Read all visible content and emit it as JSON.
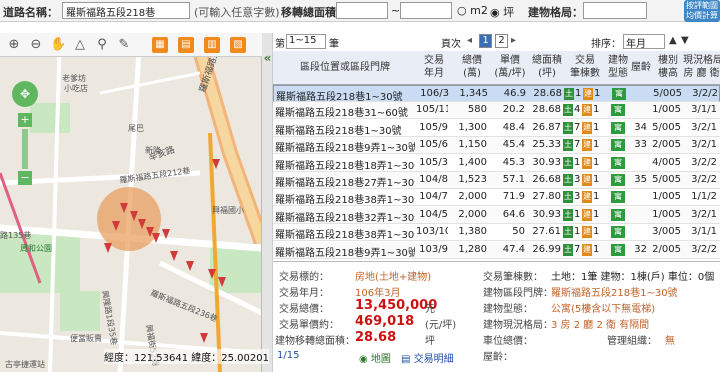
{
  "topbar": {
    "road_label": "道路名稱：",
    "road_value": "羅斯福路五段218巷",
    "road_hint": "(可輸入任意字數)",
    "area_label": "移轉總面積：",
    "area_sep": "~",
    "unit_m2": "m2",
    "unit_ping": "坪",
    "layout_label": "建物格局：",
    "calc_btn": "按評範圍均價計算"
  },
  "pager": {
    "prefix": "第",
    "range": "1~15",
    "suffix": "筆",
    "page_label": "頁次",
    "pages": [
      "1",
      "2"
    ],
    "sort_label": "排序：",
    "sort_value": "年月",
    "asc": "▲",
    "desc": "▼"
  },
  "columns": {
    "addr": "區段位置或區段門牌",
    "ym": [
      "交易",
      "年月"
    ],
    "total": [
      "總價",
      "(萬)"
    ],
    "unit": [
      "單價",
      "(萬/坪)"
    ],
    "area": [
      "總面積",
      "(坪)"
    ],
    "trans": [
      "交易",
      "筆棟數"
    ],
    "type": [
      "建物",
      "型態"
    ],
    "floor": "屋齡",
    "flr": [
      "樓別",
      "樓高"
    ],
    "layout": [
      "現況格局",
      "房 廳 衛"
    ]
  },
  "rows": [
    {
      "addr": "羅斯福路五段218巷1~30號",
      "ym": "106/3",
      "total": "1,345",
      "unit": "46.9",
      "area": "28.68",
      "land": "1",
      "bld": "1",
      "age": "",
      "flr": "5/005",
      "lay": "3/2/2"
    },
    {
      "addr": "羅斯福路五段218巷31~60號",
      "ym": "105/11",
      "total": "580",
      "unit": "20.2",
      "area": "28.68",
      "land": "4",
      "bld": "1",
      "age": "",
      "flr": "1/005",
      "lay": "3/1/1"
    },
    {
      "addr": "羅斯福路五段218巷1~30號",
      "ym": "105/9",
      "total": "1,300",
      "unit": "48.4",
      "area": "26.87",
      "land": "7",
      "bld": "1",
      "age": "34",
      "flr": "5/005",
      "lay": "3/2/1"
    },
    {
      "addr": "羅斯福路五段218巷9弄1~30號",
      "ym": "105/6",
      "total": "1,150",
      "unit": "45.4",
      "area": "25.33",
      "land": "7",
      "bld": "1",
      "age": "33",
      "flr": "2/005",
      "lay": "3/2/1"
    },
    {
      "addr": "羅斯福路五段218巷18弄1~30號",
      "ym": "105/3",
      "total": "1,400",
      "unit": "45.3",
      "area": "30.93",
      "land": "1",
      "bld": "1",
      "age": "",
      "flr": "4/005",
      "lay": "3/2/2"
    },
    {
      "addr": "羅斯福路五段218巷27弄1~30號",
      "ym": "104/8",
      "total": "1,523",
      "unit": "57.1",
      "area": "26.68",
      "land": "3",
      "bld": "1",
      "age": "35",
      "flr": "5/005",
      "lay": "3/2/2"
    },
    {
      "addr": "羅斯福路五段218巷38弄1~30號",
      "ym": "104/7",
      "total": "2,000",
      "unit": "71.9",
      "area": "27.80",
      "land": "3",
      "bld": "1",
      "age": "",
      "flr": "1/005",
      "lay": "1/1/2"
    },
    {
      "addr": "羅斯福路五段218巷32弄1~30號",
      "ym": "104/5",
      "total": "2,000",
      "unit": "64.6",
      "area": "30.93",
      "land": "1",
      "bld": "1",
      "age": "",
      "flr": "1/005",
      "lay": "3/2/1"
    },
    {
      "addr": "羅斯福路五段218巷38弄1~30號",
      "ym": "103/10",
      "total": "1,380",
      "unit": "50",
      "area": "27.61",
      "land": "1",
      "bld": "1",
      "age": "",
      "flr": "3/005",
      "lay": "3/1/1"
    },
    {
      "addr": "羅斯福路五段218巷9弄1~30號",
      "ym": "103/9",
      "total": "1,280",
      "unit": "47.4",
      "area": "26.99",
      "land": "7",
      "bld": "1",
      "age": "32",
      "flr": "2/005",
      "lay": "3/2/2"
    }
  ],
  "detail": {
    "target_k": "交易標的：",
    "target_v": "房地(土地+建物)",
    "ym_k": "交易年月：",
    "ym_v": "106年3月",
    "total_k": "交易總價：",
    "total_v": "13,450,000",
    "total_u": "元",
    "unit_k": "交易單價約：",
    "unit_v": "469,018",
    "unit_u": "(元/坪)",
    "area_k": "建物移轉總面積：",
    "area_v": "28.68",
    "area_u": "坪",
    "count_k": "交易筆棟數：",
    "count_v": "土地：1筆 建物：1棟(戶) 車位：0個",
    "door_k": "建物區段門牌：",
    "door_v": "羅斯福路五段218巷1~30號",
    "type_k": "建物型態：",
    "type_v": "公寓(5樓含以下無電梯)",
    "lay_k": "建物現況格局：",
    "lay_v": "3 房 2 廳 2 衛 有隔間",
    "park_k": "車位總價：",
    "mgmt_k": "管理組織：",
    "mgmt_v": "無",
    "age_k": "屋齡：",
    "index": "1/15",
    "map_link": "地圖",
    "detail_link": "交易明細"
  },
  "map": {
    "coords": "經度：121.53641  緯度：25.00201",
    "labels": [
      "老爹坊",
      "小吃店",
      "尾巴",
      "羅斯福路五段",
      "羅斯福路五段212巷",
      "辛亥路",
      "興福國小",
      "興隆公園",
      "路135巷",
      "周和公園",
      "新隆",
      "萬和路",
      "羅斯福路五段236巷",
      "興隆路1段35巷",
      "興福街52巷",
      "便當販賣",
      "古亭捷運站",
      "辛亥新村",
      "興福國小",
      "萬隆"
    ]
  }
}
